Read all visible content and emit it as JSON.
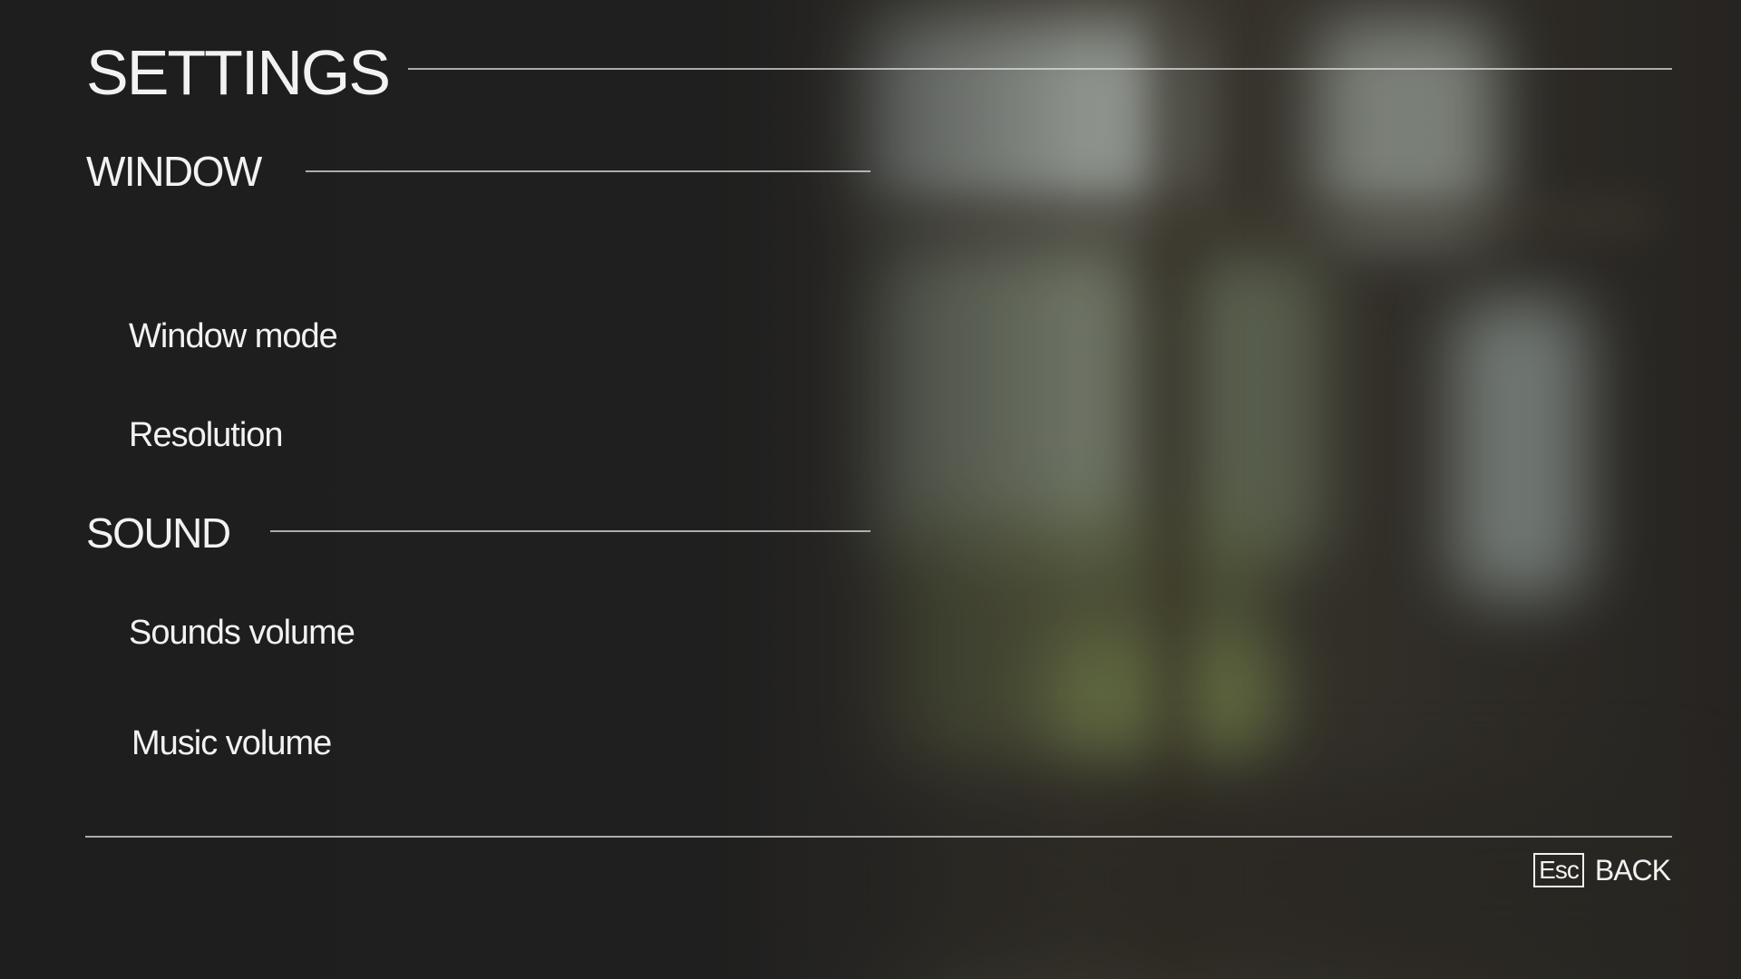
{
  "header": {
    "title": "SETTINGS"
  },
  "sections": {
    "window": {
      "label": "WINDOW",
      "items": {
        "window_mode": "Window mode",
        "resolution": "Resolution"
      }
    },
    "sound": {
      "label": "SOUND",
      "items": {
        "sounds_volume": "Sounds volume",
        "music_volume": "Music volume"
      }
    }
  },
  "footer": {
    "back_key": "Esc",
    "back_label": "BACK"
  },
  "colors": {
    "text": "#f2f2f2",
    "rule": "#dcdcdc",
    "panel": "#212121"
  }
}
